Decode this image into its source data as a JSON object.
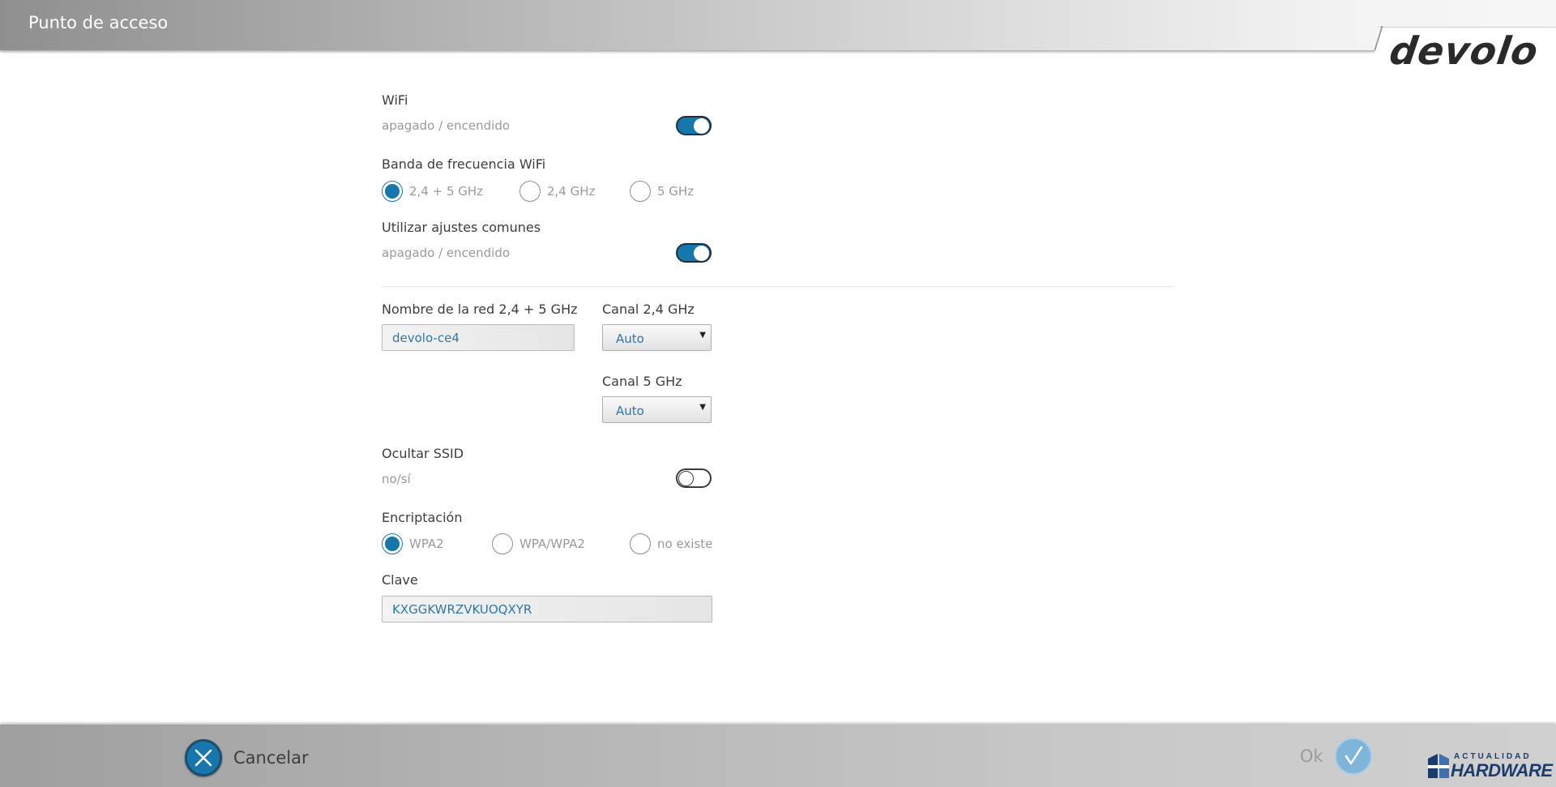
{
  "header": {
    "title": "Punto de acceso",
    "logo_text": "devolo"
  },
  "wifi": {
    "label": "WiFi",
    "sublabel": "apagado / encendido",
    "enabled": true
  },
  "band": {
    "label": "Banda de frecuencia WiFi",
    "options": [
      "2,4 + 5 GHz",
      "2,4 GHz",
      "5 GHz"
    ],
    "selected": "2,4 + 5 GHz"
  },
  "common_settings": {
    "label": "Utilizar ajustes comunes",
    "sublabel": "apagado / encendido",
    "enabled": true
  },
  "network_name": {
    "label": "Nombre de la red 2,4 + 5 GHz",
    "value": "devolo-ce4"
  },
  "channel_24": {
    "label": "Canal 2,4 GHz",
    "value": "Auto"
  },
  "channel_5": {
    "label": "Canal 5 GHz",
    "value": "Auto"
  },
  "hide_ssid": {
    "label": "Ocultar SSID",
    "sublabel": "no/sí",
    "enabled": false
  },
  "encryption": {
    "label": "Encriptación",
    "options": [
      "WPA2",
      "WPA/WPA2",
      "no existe"
    ],
    "selected": "WPA2"
  },
  "key": {
    "label": "Clave",
    "value": "KXGGKWRZVKUOQXYR"
  },
  "footer": {
    "cancel_label": "Cancelar",
    "ok_label": "Ok",
    "brand_top": "ACTUALIDAD",
    "brand_bottom": "HARDWARE"
  },
  "colors": {
    "accent": "#1677ac",
    "header_text": "#ffffff",
    "value_text": "#2f78a6"
  }
}
